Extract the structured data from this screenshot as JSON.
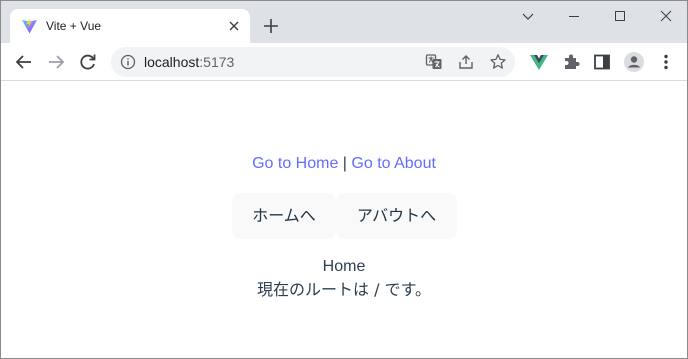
{
  "browser": {
    "tab": {
      "title": "Vite + Vue",
      "favicon": "vite-logo-icon",
      "close_icon": "close-icon"
    },
    "new_tab_icon": "plus-icon",
    "window_controls": [
      "chevron-down-icon",
      "minimize-icon",
      "maximize-icon",
      "close-icon"
    ],
    "address_bar": {
      "host": "localhost",
      "port": ":5173"
    },
    "toolbar_icons": [
      "back-icon",
      "forward-icon",
      "reload-icon",
      "info-icon",
      "translate-icon",
      "share-icon",
      "star-icon",
      "vue-devtools-icon",
      "extensions-icon",
      "side-panel-icon",
      "profile-icon",
      "more-icon"
    ]
  },
  "page": {
    "nav": {
      "home_link": "Go to Home",
      "separator": "|",
      "about_link": "Go to About"
    },
    "buttons": {
      "home": "ホームへ",
      "about": "アバウトへ"
    },
    "route_name": "Home",
    "route_message": "現在のルートは / です。"
  },
  "colors": {
    "link": "#646cff",
    "text": "#2c3e50",
    "button_bg": "#f9f9f9",
    "tabstrip_bg": "#dee1e6"
  }
}
